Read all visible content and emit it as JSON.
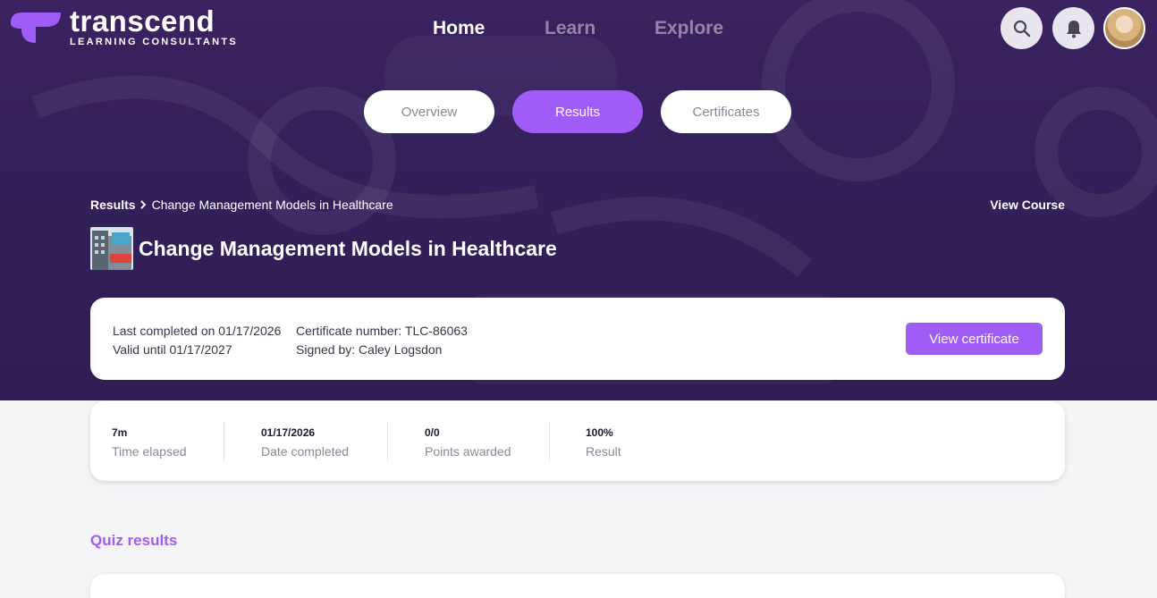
{
  "brand": {
    "name": "transcend",
    "tagline": "LEARNING CONSULTANTS",
    "accent": "#a05cf7"
  },
  "topnav": {
    "home": "Home",
    "learn": "Learn",
    "explore": "Explore"
  },
  "tabs": {
    "overview": "Overview",
    "results": "Results",
    "certificates": "Certificates"
  },
  "breadcrumb": {
    "root": "Results",
    "current": "Change Management Models in Healthcare"
  },
  "view_course": "View Course",
  "course": {
    "title": "Change Management Models in Healthcare"
  },
  "certificate": {
    "last_completed": "Last completed on 01/17/2026",
    "valid_until": "Valid until 01/17/2027",
    "number": "Certificate number: TLC-86063",
    "signed_by": "Signed by: Caley Logsdon",
    "button": "View certificate"
  },
  "stats": [
    {
      "value": "7m",
      "label": "Time elapsed"
    },
    {
      "value": "01/17/2026",
      "label": "Date completed"
    },
    {
      "value": "0/0",
      "label": "Points awarded"
    },
    {
      "value": "100%",
      "label": "Result"
    }
  ],
  "quiz_results_title": "Quiz results"
}
